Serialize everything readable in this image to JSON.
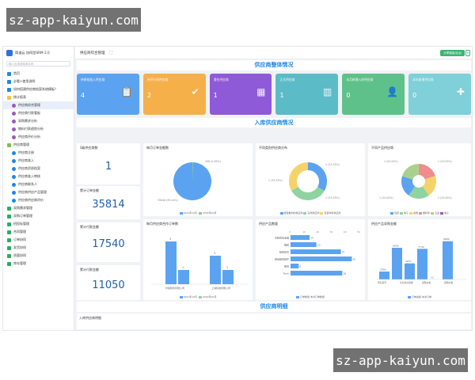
{
  "app": {
    "title": "简道云 协同型SRM 2.0",
    "search_placeholder": "输入应用或菜单名称"
  },
  "sidebar": {
    "items": [
      {
        "label": "首页",
        "color": "#1e88e5",
        "indent": false,
        "active": false
      },
      {
        "label": "必看+使用说明",
        "color": "#1e88e5",
        "indent": false,
        "active": false
      },
      {
        "label": "如何搭建供应商档案系统模板？",
        "color": "#1e88e5",
        "indent": false,
        "active": false
      },
      {
        "label": "统计报表",
        "color": "#f5c343",
        "indent": false,
        "active": false
      },
      {
        "label": "供应商综合管理",
        "color": "#9b59b6",
        "indent": true,
        "active": true
      },
      {
        "label": "供应商付款看板",
        "color": "#9b59b6",
        "indent": true,
        "active": false
      },
      {
        "label": "采购需求分析",
        "color": "#9b59b6",
        "indent": true,
        "active": false
      },
      {
        "label": "物料付款趋势分析",
        "color": "#9b59b6",
        "indent": true,
        "active": false
      },
      {
        "label": "供应商评价分析",
        "color": "#9b59b6",
        "indent": true,
        "active": false
      },
      {
        "label": "供应商管理",
        "color": "#7fbf4d",
        "indent": false,
        "active": false
      },
      {
        "label": "供应商注册",
        "color": "#1e88e5",
        "indent": true,
        "active": false
      },
      {
        "label": "供应商准入",
        "color": "#1e88e5",
        "indent": true,
        "active": false
      },
      {
        "label": "供应商资质档案",
        "color": "#1e88e5",
        "indent": true,
        "active": false
      },
      {
        "label": "供应商准入审核",
        "color": "#1e88e5",
        "indent": true,
        "active": false
      },
      {
        "label": "供应商联系人",
        "color": "#1e88e5",
        "indent": true,
        "active": false
      },
      {
        "label": "供应商供应产品管理",
        "color": "#1e88e5",
        "indent": true,
        "active": false
      },
      {
        "label": "供应商供应商评价",
        "color": "#1e88e5",
        "indent": true,
        "active": false
      },
      {
        "label": "采购需求管理",
        "color": "#27ae60",
        "indent": false,
        "active": false
      },
      {
        "label": "采购订单管理",
        "color": "#27ae60",
        "indent": false,
        "active": false
      },
      {
        "label": "招投标管理",
        "color": "#27ae60",
        "indent": false,
        "active": false
      },
      {
        "label": "合同管理",
        "color": "#27ae60",
        "indent": false,
        "active": false
      },
      {
        "label": "订单协同",
        "color": "#27ae60",
        "indent": false,
        "active": false
      },
      {
        "label": "发货协同",
        "color": "#27ae60",
        "indent": false,
        "active": false
      },
      {
        "label": "质量协同",
        "color": "#27ae60",
        "indent": false,
        "active": false
      },
      {
        "label": "库存管理",
        "color": "#27ae60",
        "indent": false,
        "active": false
      }
    ]
  },
  "topbar": {
    "tab": "供应商综合管理",
    "fullscreen_icon": "expand-icon",
    "button_label": "分享链接/后台"
  },
  "overview": {
    "title": "供应商整体情况",
    "cards": [
      {
        "label": "待审核准入供应商",
        "value": "4",
        "color": "#5ba3f0",
        "icon": "clipboard-icon"
      },
      {
        "label": "待评分的供应商",
        "value": "2",
        "color": "#f5b04a",
        "icon": "checklist-icon"
      },
      {
        "label": "潜在供应商",
        "value": "1",
        "color": "#8e5ad8",
        "icon": "table-icon"
      },
      {
        "label": "正式供应商",
        "value": "1",
        "color": "#5bbcc8",
        "icon": "box-icon"
      },
      {
        "label": "本月新增入库供应商",
        "value": "0",
        "color": "#5fc18a",
        "icon": "user-icon"
      },
      {
        "label": "本年新增供应商",
        "value": "0",
        "color": "#7fd0d8",
        "icon": "puzzle-icon"
      }
    ]
  },
  "inbound": {
    "title": "入库供应商情况",
    "stats": [
      {
        "label": "S级供应商数",
        "value": "1"
      },
      {
        "label": "累计订单金额",
        "value": "35814"
      },
      {
        "label": "累计付款金额",
        "value": "17540"
      },
      {
        "label": "累计付款金额",
        "value": "11050"
      }
    ],
    "monthly_pie": {
      "title": "每月订单金额数",
      "labels": [
        "2021年12月",
        "2022年01月"
      ],
      "annotations": [
        "266 (0.56%)",
        "35648 (99.44%)"
      ]
    },
    "category_donut": {
      "title": "不同类别供应商分布",
      "legend": [
        "慢慢看到的供应商",
        "实用供应商",
        "包装材料供应商"
      ],
      "annotations": [
        "1 (33.33%)",
        "1 (33.33%)",
        "1 (33.33%)"
      ]
    },
    "product_donut": {
      "title": "不同产品供应商",
      "legend": [
        "包装",
        "电子",
        "金属",
        "塑料件",
        "五金",
        "电子"
      ],
      "annotations": [
        "1 (20.00%)",
        "1 (20.00%)",
        "1 (20.00%)",
        "1 (20.00%)"
      ]
    },
    "bar_cooperation": {
      "title": "每月供应商合作订单数",
      "categories": [
        "华丽软件有限公司",
        "上城科技有限公司"
      ],
      "values_a": [
        3,
        2
      ],
      "values_b": [
        1,
        1
      ],
      "legend": [
        "2021年12月",
        "2022年01月"
      ]
    },
    "bar_products": {
      "title": "供应产品数量",
      "categories": [
        "高精密加速器",
        "塑胶",
        "精密模块",
        "玻璃壁纸配件",
        "螺母",
        "Rack"
      ],
      "values": [
        14,
        19,
        37,
        45,
        6,
        38
      ],
      "axis": [
        "0",
        "10",
        "20",
        "30",
        "40",
        "50"
      ],
      "legend": "订单数量 本次订单数量"
    },
    "bar_purchase": {
      "title": "供应产品采购金额",
      "values": [
        2000,
        8000,
        4057,
        7740,
        12,
        9660
      ],
      "labels": [
        "2000",
        "8000",
        "4057",
        "7740",
        "12",
        "9660"
      ],
      "categories": [
        "首信型号",
        "信控总价格等",
        "采购价格",
        "采购价格"
      ],
      "legend": "订单金额 本次订单"
    }
  },
  "details": {
    "title": "供应商明细",
    "sub_label": "入库供应商明细"
  },
  "watermark": {
    "text": "sz-app-kaiyun.com"
  }
}
